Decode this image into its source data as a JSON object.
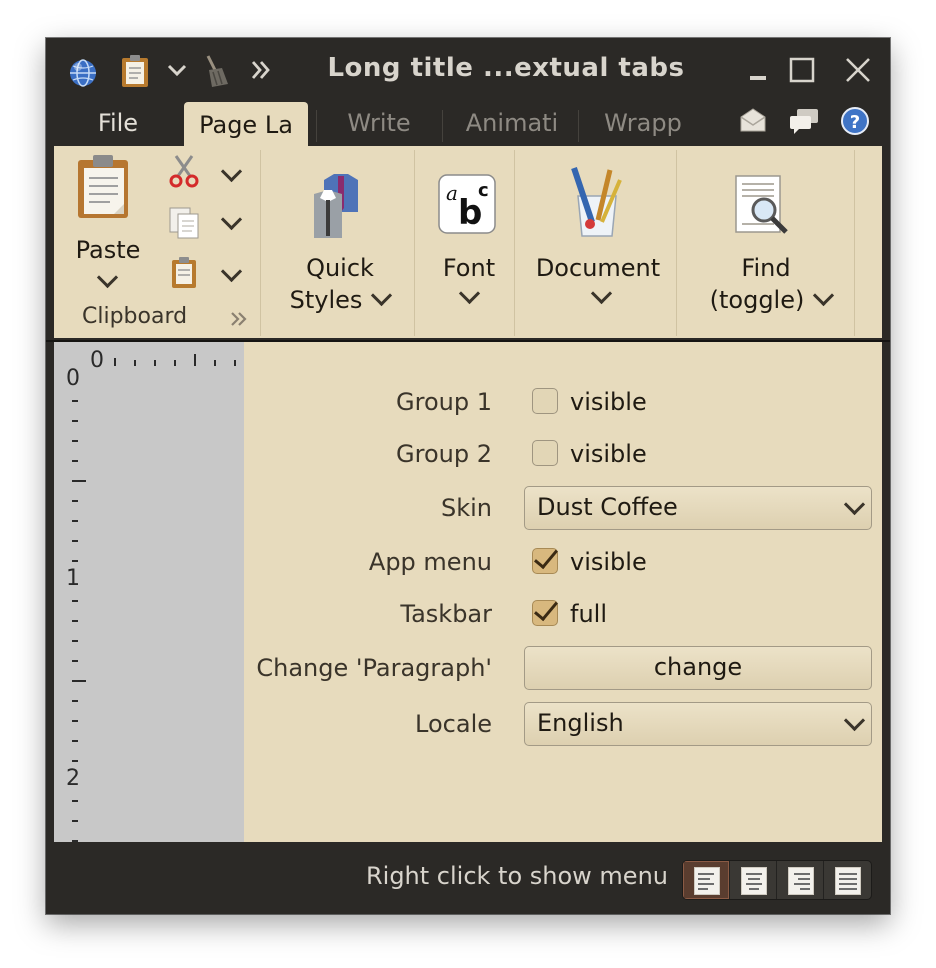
{
  "window": {
    "title": "Long title ...extual tabs"
  },
  "tabs": [
    {
      "label": "File",
      "active": false
    },
    {
      "label": "Page La",
      "active": true
    },
    {
      "label": "Write",
      "active": false
    },
    {
      "label": "Animati",
      "active": false
    },
    {
      "label": "Wrapp",
      "active": false
    }
  ],
  "ribbon": {
    "paste_label": "Paste",
    "clipboard_band": "Clipboard",
    "quick_styles_line1": "Quick",
    "quick_styles_line2": "Styles",
    "font_label": "Font",
    "document_label": "Document",
    "find_line1": "Find",
    "find_line2": "(toggle)"
  },
  "ruler": {
    "horizontal_origin": "0",
    "vertical_labels": [
      "0",
      "1",
      "2"
    ]
  },
  "form": {
    "group1": {
      "label": "Group 1",
      "checkbox_label": "visible",
      "checked": false
    },
    "group2": {
      "label": "Group 2",
      "checkbox_label": "visible",
      "checked": false
    },
    "skin": {
      "label": "Skin",
      "value": "Dust Coffee"
    },
    "app_menu": {
      "label": "App menu",
      "checkbox_label": "visible",
      "checked": true
    },
    "taskbar": {
      "label": "Taskbar",
      "checkbox_label": "full",
      "checked": true
    },
    "change_paragraph": {
      "label": "Change 'Paragraph'",
      "button_label": "change"
    },
    "locale": {
      "label": "Locale",
      "value": "English"
    }
  },
  "status": {
    "text": "Right click to show menu",
    "alignment_buttons": [
      "align-left-icon",
      "align-center-icon",
      "align-right-icon",
      "align-justify-icon"
    ],
    "selected_alignment": "align-left-icon"
  },
  "colors": {
    "ribbon_bg": "#e7dbbd",
    "chrome_bg": "#2b2926",
    "ruler_bg": "#c8c8c8",
    "selected_align_bg": "#5a3d2f"
  }
}
